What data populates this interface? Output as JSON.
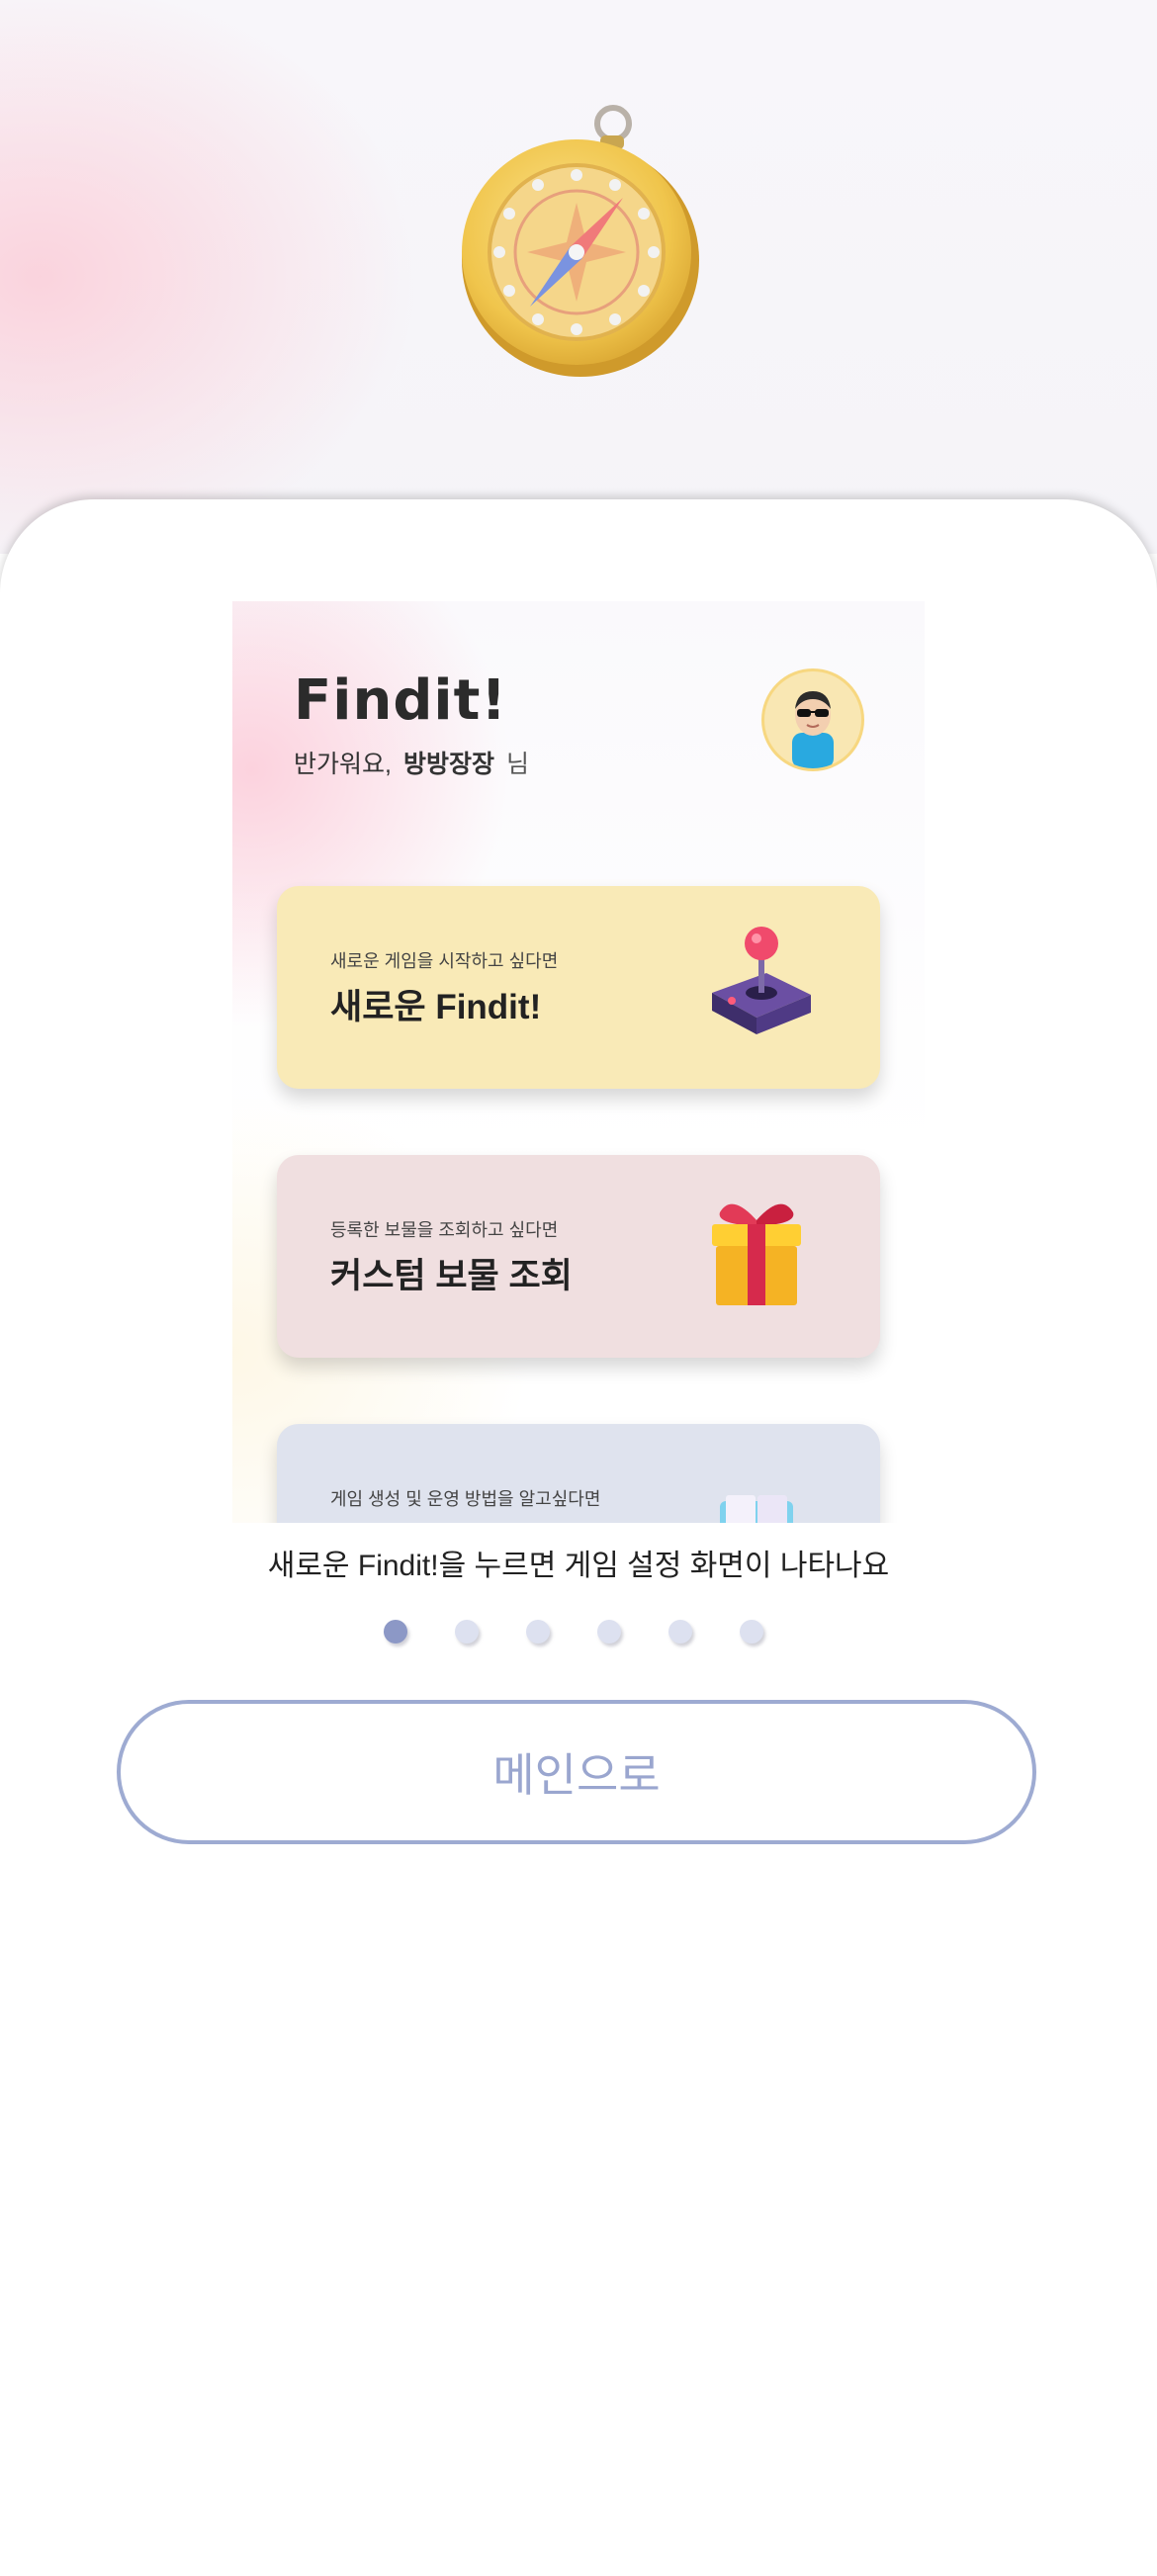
{
  "preview": {
    "app_title": "Findit!",
    "greeting": "반가워요,",
    "nickname": "방방장장",
    "suffix": "님",
    "cards": [
      {
        "sub": "새로운 게임을 시작하고 싶다면",
        "title": "새로운 Findit!",
        "icon": "joystick-icon"
      },
      {
        "sub": "등록한 보물을 조회하고 싶다면",
        "title": "커스텀 보물 조회",
        "icon": "gift-icon"
      },
      {
        "sub": "게임 생성 및 운영 방법을 알고싶다면",
        "title": "",
        "icon": "book-icon"
      }
    ]
  },
  "caption": "새로운 Findit!을 누르면 게임 설정 화면이 나타나요",
  "pager": {
    "total": 6,
    "active_index": 0
  },
  "main_button": "메인으로",
  "colors": {
    "accent": "#9eabd2",
    "card_yellow": "#f9eab7",
    "card_pink": "#f0dfe0",
    "card_blue": "#dfe3ee"
  }
}
